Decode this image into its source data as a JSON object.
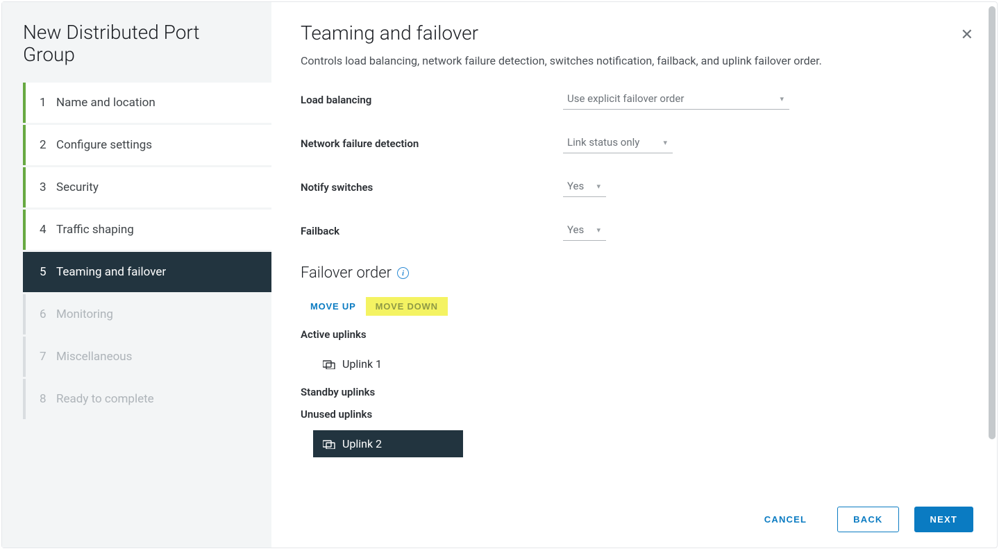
{
  "sidebar": {
    "title": "New Distributed Port Group",
    "steps": [
      {
        "num": "1",
        "label": "Name and location",
        "state": "completed"
      },
      {
        "num": "2",
        "label": "Configure settings",
        "state": "completed"
      },
      {
        "num": "3",
        "label": "Security",
        "state": "completed"
      },
      {
        "num": "4",
        "label": "Traffic shaping",
        "state": "completed"
      },
      {
        "num": "5",
        "label": "Teaming and failover",
        "state": "active"
      },
      {
        "num": "6",
        "label": "Monitoring",
        "state": "pending"
      },
      {
        "num": "7",
        "label": "Miscellaneous",
        "state": "pending"
      },
      {
        "num": "8",
        "label": "Ready to complete",
        "state": "pending"
      }
    ]
  },
  "main": {
    "title": "Teaming and failover",
    "description": "Controls load balancing, network failure detection, switches notification, failback, and uplink failover order.",
    "fields": {
      "load_balancing": {
        "label": "Load balancing",
        "value": "Use explicit failover order"
      },
      "network_failure": {
        "label": "Network failure detection",
        "value": "Link status only"
      },
      "notify_switches": {
        "label": "Notify switches",
        "value": "Yes"
      },
      "failback": {
        "label": "Failback",
        "value": "Yes"
      }
    },
    "failover": {
      "title": "Failover order",
      "move_up": "MOVE UP",
      "move_down": "MOVE DOWN",
      "active_header": "Active uplinks",
      "standby_header": "Standby uplinks",
      "unused_header": "Unused uplinks",
      "active_items": [
        "Uplink 1"
      ],
      "standby_items": [],
      "unused_items": [
        "Uplink 2"
      ],
      "selected": "Uplink 2"
    }
  },
  "footer": {
    "cancel": "CANCEL",
    "back": "BACK",
    "next": "NEXT"
  }
}
